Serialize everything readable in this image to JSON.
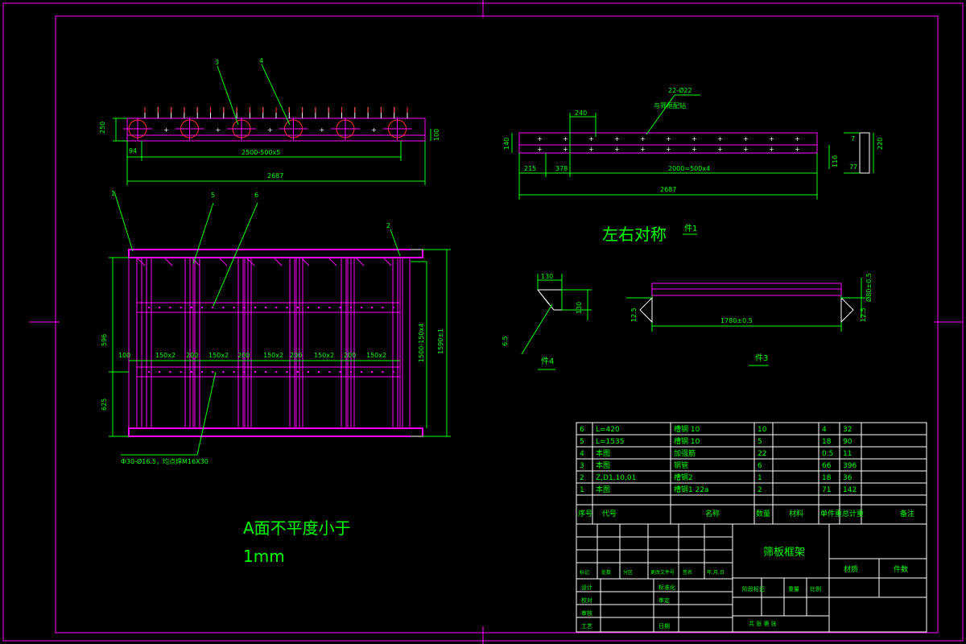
{
  "notes": {
    "symmetry": "左右对称",
    "flatness_line1": "A面不平度小于",
    "flatness_line2": "1mm",
    "part1": "件1",
    "part3": "件3",
    "part4": "件4"
  },
  "dims": {
    "top_h": "250",
    "top_94": "94",
    "top_span": "2500-500x5",
    "top_total": "2687",
    "top_right": "100",
    "balloon3": "3",
    "balloon4": "4",
    "r_22": "22-Ø22",
    "r_weld": "与筛框配钻",
    "r_240": "240",
    "r_140": "140",
    "r_215": "215",
    "r_378": "378",
    "r_span": "2000=500x4",
    "r_total": "2687",
    "r_110": "110",
    "r_7": "7",
    "r_77": "77",
    "r_220": "220",
    "b1": "1",
    "b5": "5",
    "b6": "6",
    "b2": "2",
    "f_100": "100",
    "f_150": "150x2",
    "f_200": "200",
    "f_left1": "596",
    "f_left2": "625",
    "f_right1": "1500-150x4",
    "f_right2": "1590±1",
    "f_hole": "Ф30-Ø16.5，均点焊M16X30",
    "d_130a": "130",
    "d_130b": "130",
    "d_65": "6.5",
    "d_125a": "12.5",
    "d_125b": "12.5",
    "d_1780": "1780±0.5",
    "d_80": "Ø80±0.5"
  },
  "bom": [
    {
      "seq": "6",
      "code": "L=420",
      "name": "槽钢 10",
      "qty": "10",
      "mat": "",
      "unit": "4",
      "total": "32",
      "note": ""
    },
    {
      "seq": "5",
      "code": "L=1535",
      "name": "槽钢 10",
      "qty": "5",
      "mat": "",
      "unit": "18",
      "total": "90",
      "note": ""
    },
    {
      "seq": "4",
      "code": "本图",
      "name": "加强筋",
      "qty": "22",
      "mat": "",
      "unit": "0.5",
      "total": "11",
      "note": ""
    },
    {
      "seq": "3",
      "code": "本图",
      "name": "钢管",
      "qty": "6",
      "mat": "",
      "unit": "66",
      "total": "396",
      "note": ""
    },
    {
      "seq": "2",
      "code": "Z,D1,10,01",
      "name": "槽钢2",
      "qty": "1",
      "mat": "",
      "unit": "18",
      "total": "36",
      "note": ""
    },
    {
      "seq": "1",
      "code": "本图",
      "name": "槽钢1 22a",
      "qty": "2",
      "mat": "",
      "unit": "71",
      "total": "142",
      "note": ""
    }
  ],
  "bom_header": {
    "seq": "序号",
    "code": "代号",
    "name": "名称",
    "qty": "数量",
    "mat": "材料",
    "unit": "单件重",
    "total": "总计重",
    "note": "备注"
  },
  "title_block": {
    "drawing_name": "筛板框架",
    "material": "材质",
    "pieces": "件数",
    "rev_labels": [
      "标记",
      "处数",
      "分区",
      "更改文件号",
      "签名",
      "年,月,日"
    ],
    "design": "设计",
    "standard": "标准化",
    "check": "校对",
    "review": "审定",
    "audit": "审核",
    "process": "工艺",
    "approve": "日期",
    "stage": "阶段标记",
    "weight": "重量",
    "ratio": "比例",
    "sheet": "共 张 第 张"
  }
}
